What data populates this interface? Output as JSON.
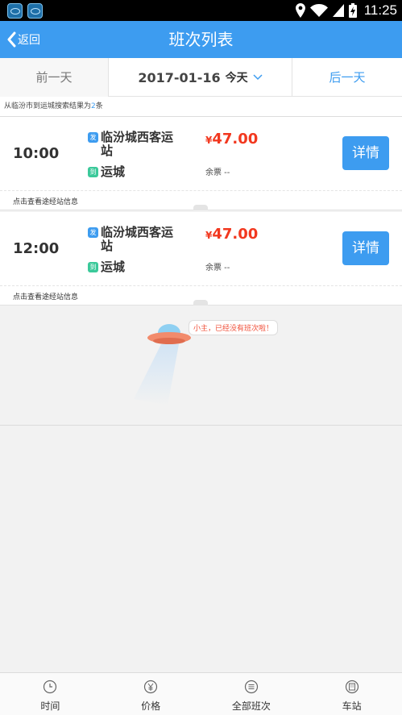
{
  "status_bar": {
    "time": "11:25",
    "icons": [
      "app-icon",
      "app-icon",
      "location-icon",
      "wifi-icon",
      "signal-icon",
      "battery-icon"
    ]
  },
  "header": {
    "back_label": "返回",
    "title": "班次列表"
  },
  "date_bar": {
    "prev_label": "前一天",
    "date": "2017-01-16",
    "today_label": "今天",
    "next_label": "后一天"
  },
  "summary": {
    "prefix": "从临汾市到运城搜索结果为",
    "count": "2",
    "suffix": "条"
  },
  "trips": [
    {
      "time": "10:00",
      "from_tag": "发",
      "from_station": "临汾城西客运站",
      "to_tag": "到",
      "to_station": "运城",
      "currency": "¥",
      "price": "47.00",
      "seats": "余票 --",
      "detail_label": "详情",
      "via_info": "点击查看途经站信息"
    },
    {
      "time": "12:00",
      "from_tag": "发",
      "from_station": "临汾城西客运站",
      "to_tag": "到",
      "to_station": "运城",
      "currency": "¥",
      "price": "47.00",
      "seats": "余票 --",
      "detail_label": "详情",
      "via_info": "点击查看途经站信息"
    }
  ],
  "empty_message": "小主，已经没有班次啦！",
  "tab_bar": [
    {
      "label": "时间",
      "icon": "clock-icon"
    },
    {
      "label": "价格",
      "icon": "price-icon"
    },
    {
      "label": "全部班次",
      "icon": "list-icon"
    },
    {
      "label": "车站",
      "icon": "station-icon"
    }
  ],
  "colors": {
    "primary": "#3d9cf0",
    "price": "#f2381f",
    "arrive_tag": "#3bc99a"
  }
}
